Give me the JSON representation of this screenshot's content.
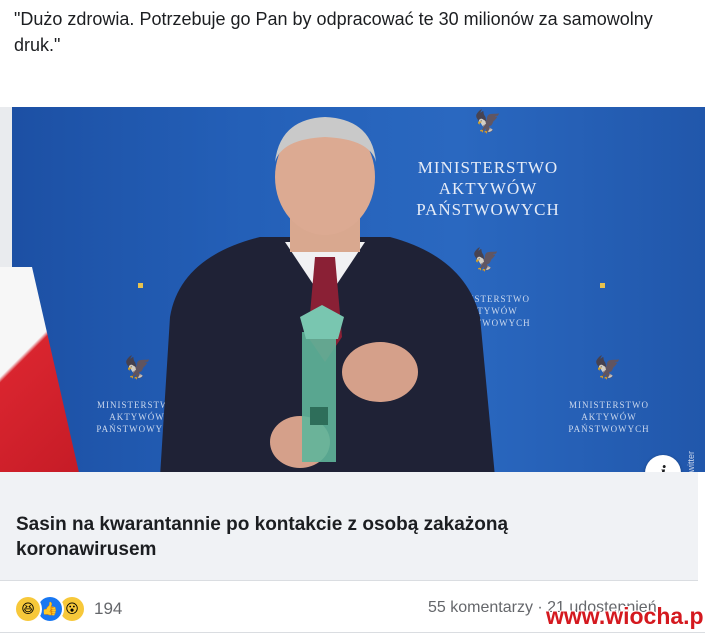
{
  "post": {
    "text": "\"Dużo zdrowia. Potrzebuje go Pan by odpracować te 30 milionów za samowolny druk.\""
  },
  "media": {
    "ministry_large": [
      "MINISTERSTWO",
      "AKTYWÓW",
      "PAŃSTWOWYCH"
    ],
    "ministry_small": [
      "MINISTERSTWO",
      "AKTYWÓW",
      "PAŃSTWOWYCH"
    ],
    "side_watermark": "screen: twitter",
    "info_label": "i"
  },
  "link": {
    "title": "Sasin na kwarantannie po kontakcie z osobą zakażoną koronawirusem"
  },
  "footer": {
    "reaction_count": "194",
    "comments_text": "55 komentarzy · 21 udostępnień",
    "watermark": "www.wiocha.pl"
  },
  "colors": {
    "backdrop_blue": "#2460b8",
    "flag_red": "#d9252f",
    "like_blue": "#1877f2",
    "watermark_red": "#d4191f"
  },
  "icons": [
    "haha-reaction-icon",
    "like-reaction-icon",
    "wow-reaction-icon",
    "info-icon"
  ]
}
